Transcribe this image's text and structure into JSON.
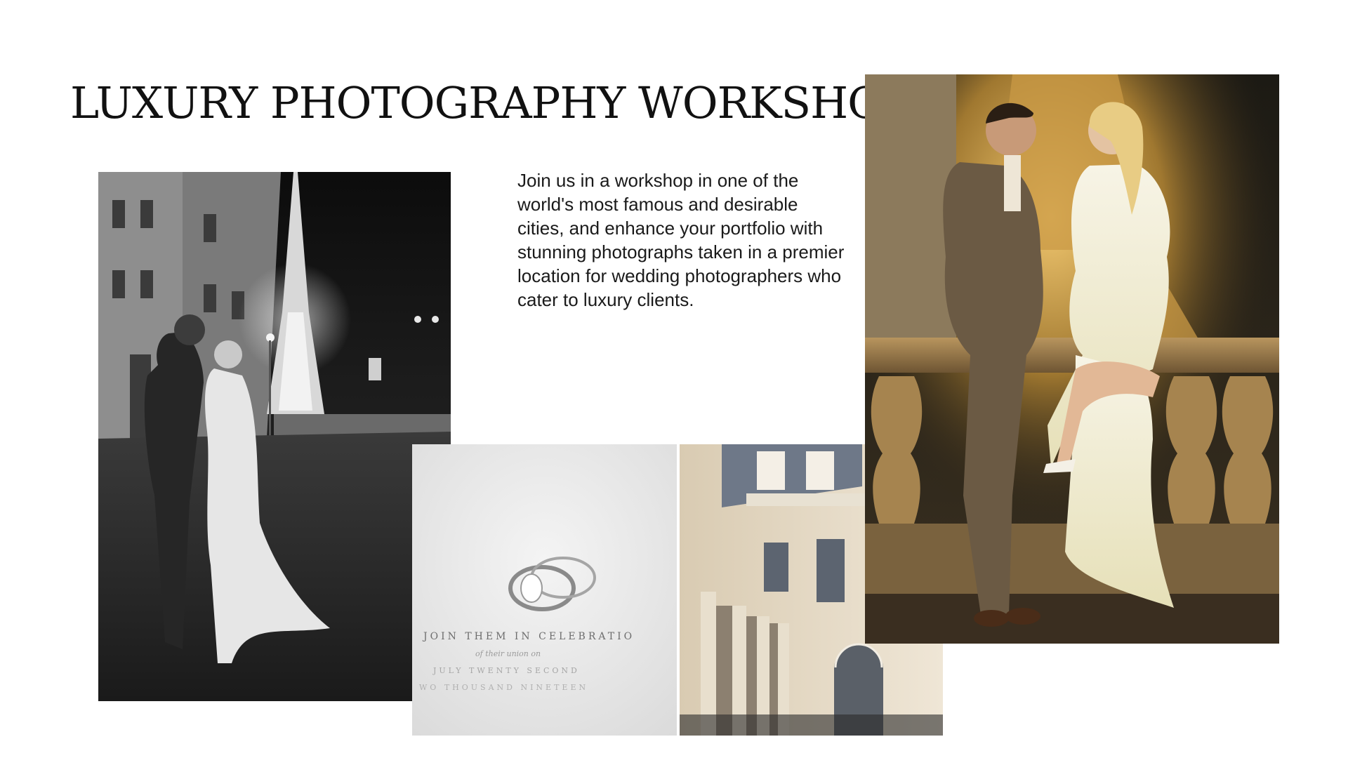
{
  "slide": {
    "title": "LUXURY PHOTOGRAPHY WORKSHOP",
    "body": "Join us in a workshop in one of the world's most famous and desirable cities, and enhance your portfolio with stunning photographs taken in a premier location for wedding photographers who cater to luxury clients."
  },
  "photos": {
    "rings": {
      "card_line_1": "JOIN THEM IN CELEBRATIO",
      "card_line_2": "of their union on",
      "card_line_3": "JULY TWENTY SECOND",
      "card_line_4": "WO THOUSAND NINETEEN"
    }
  },
  "colors": {
    "background": "#ffffff",
    "title": "#111111",
    "body": "#1a1a1a"
  }
}
